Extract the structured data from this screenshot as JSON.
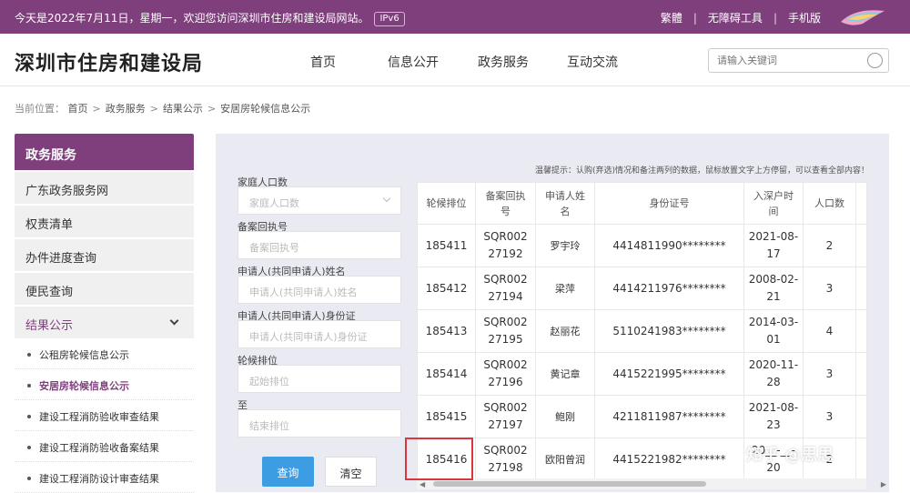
{
  "topbar": {
    "greeting": "今天是2022年7月11日，星期一，欢迎您访问深圳市住房和建设局网站。",
    "ipv6": "IPv6",
    "links": [
      "繁體",
      "无障碍工具",
      "手机版"
    ]
  },
  "header": {
    "site_title": "深圳市住房和建设局",
    "nav": [
      "首页",
      "信息公开",
      "政务服务",
      "互动交流"
    ],
    "search_placeholder": "请输入关键词"
  },
  "breadcrumb": {
    "label": "当前位置：",
    "items": [
      "首页",
      "政务服务",
      "结果公示",
      "安居房轮候信息公示"
    ]
  },
  "sidebar": {
    "title": "政务服务",
    "items": [
      "广东政务服务网",
      "权责清单",
      "办件进度查询",
      "便民查询"
    ],
    "open_section": "结果公示",
    "sub_items": [
      "公租房轮候信息公示",
      "安居房轮候信息公示",
      "建设工程消防验收审查结果",
      "建设工程消防验收备案结果",
      "建设工程消防设计审查结果"
    ],
    "active_sub": "安居房轮候信息公示"
  },
  "form": {
    "fields": [
      {
        "label": "家庭人口数",
        "placeholder": "家庭人口数",
        "dropdown": true
      },
      {
        "label": "备案回执号",
        "placeholder": "备案回执号"
      },
      {
        "label": "申请人(共同申请人)姓名",
        "placeholder": "申请人(共同申请人)姓名"
      },
      {
        "label": "申请人(共同申请人)身份证",
        "placeholder": "申请人(共同申请人)身份证"
      },
      {
        "label": "轮候排位",
        "placeholder": "起始排位"
      },
      {
        "label": "至",
        "placeholder": "结束排位"
      }
    ],
    "query_label": "查询",
    "clear_label": "清空"
  },
  "tip": "温馨提示：认购(弃选)情况和备注两列的数据，鼠标放置文字上方停留，可以查看全部内容！",
  "table": {
    "headers": [
      "轮候排位",
      "备案回执号",
      "申请人姓名",
      "身份证号",
      "入深户时间",
      "人口数"
    ],
    "rows": [
      {
        "rank": "185411",
        "receipt": "SQR00227192",
        "name": "罗宇玲",
        "id": "4414811990********",
        "date": "2021-08-17",
        "count": "2"
      },
      {
        "rank": "185412",
        "receipt": "SQR00227194",
        "name": "梁萍",
        "id": "4414211976********",
        "date": "2008-02-21",
        "count": "3"
      },
      {
        "rank": "185413",
        "receipt": "SQR00227195",
        "name": "赵丽花",
        "id": "5110241983********",
        "date": "2014-03-01",
        "count": "4"
      },
      {
        "rank": "185414",
        "receipt": "SQR00227196",
        "name": "黄记章",
        "id": "4415221995********",
        "date": "2020-11-28",
        "count": "3"
      },
      {
        "rank": "185415",
        "receipt": "SQR00227197",
        "name": "鲍刚",
        "id": "4211811987********",
        "date": "2021-08-23",
        "count": "3"
      },
      {
        "rank": "185416",
        "receipt": "SQR00227198",
        "name": "欧阳曾润",
        "id": "4415221982********",
        "date": "20__-__-20",
        "count": "2"
      }
    ]
  },
  "watermark": "知乎 @思思",
  "colors": {
    "brand": "#7e3f7c",
    "button": "#3d9de3",
    "highlight": "#d9363e"
  }
}
